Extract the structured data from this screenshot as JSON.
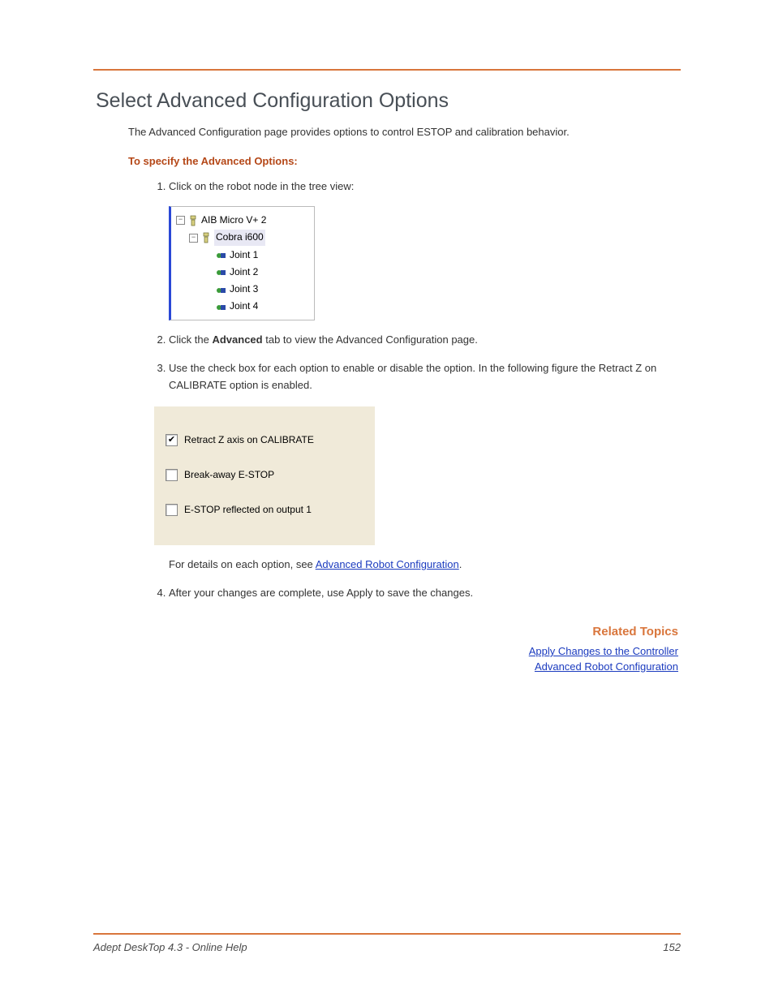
{
  "heading": "Select Advanced Configuration Options",
  "intro": "The Advanced Configuration page provides options to control ESTOP and calibration behavior.",
  "subhead": "To specify the Advanced Options:",
  "steps": {
    "s1": "Click on the robot node in the tree view:",
    "s2_pre": "Click the ",
    "s2_bold": "Advanced",
    "s2_post": " tab to view the Advanced Configuration page.",
    "s3": "Use the check box for each option to enable or disable the option. In the following figure the Retract Z on CALIBRATE option is enabled.",
    "s3_after_pre": "For details on each option, see ",
    "s3_after_link": "Advanced Robot Configuration",
    "s3_after_post": ".",
    "s4": "After your changes are complete, use Apply to save the changes."
  },
  "tree": {
    "root": "AIB Micro V+ 2",
    "child": "Cobra i600",
    "joints": [
      "Joint 1",
      "Joint 2",
      "Joint 3",
      "Joint 4"
    ]
  },
  "checkboxes": {
    "cb1": {
      "label": "Retract Z axis on CALIBRATE",
      "checked": true
    },
    "cb2": {
      "label": "Break-away E-STOP",
      "checked": false
    },
    "cb3": {
      "label": "E-STOP reflected on output 1",
      "checked": false
    }
  },
  "related": {
    "heading": "Related Topics",
    "links": [
      "Apply Changes to the Controller",
      "Advanced Robot Configuration"
    ]
  },
  "footer": {
    "left": "Adept DeskTop 4.3  - Online Help",
    "right": "152"
  }
}
